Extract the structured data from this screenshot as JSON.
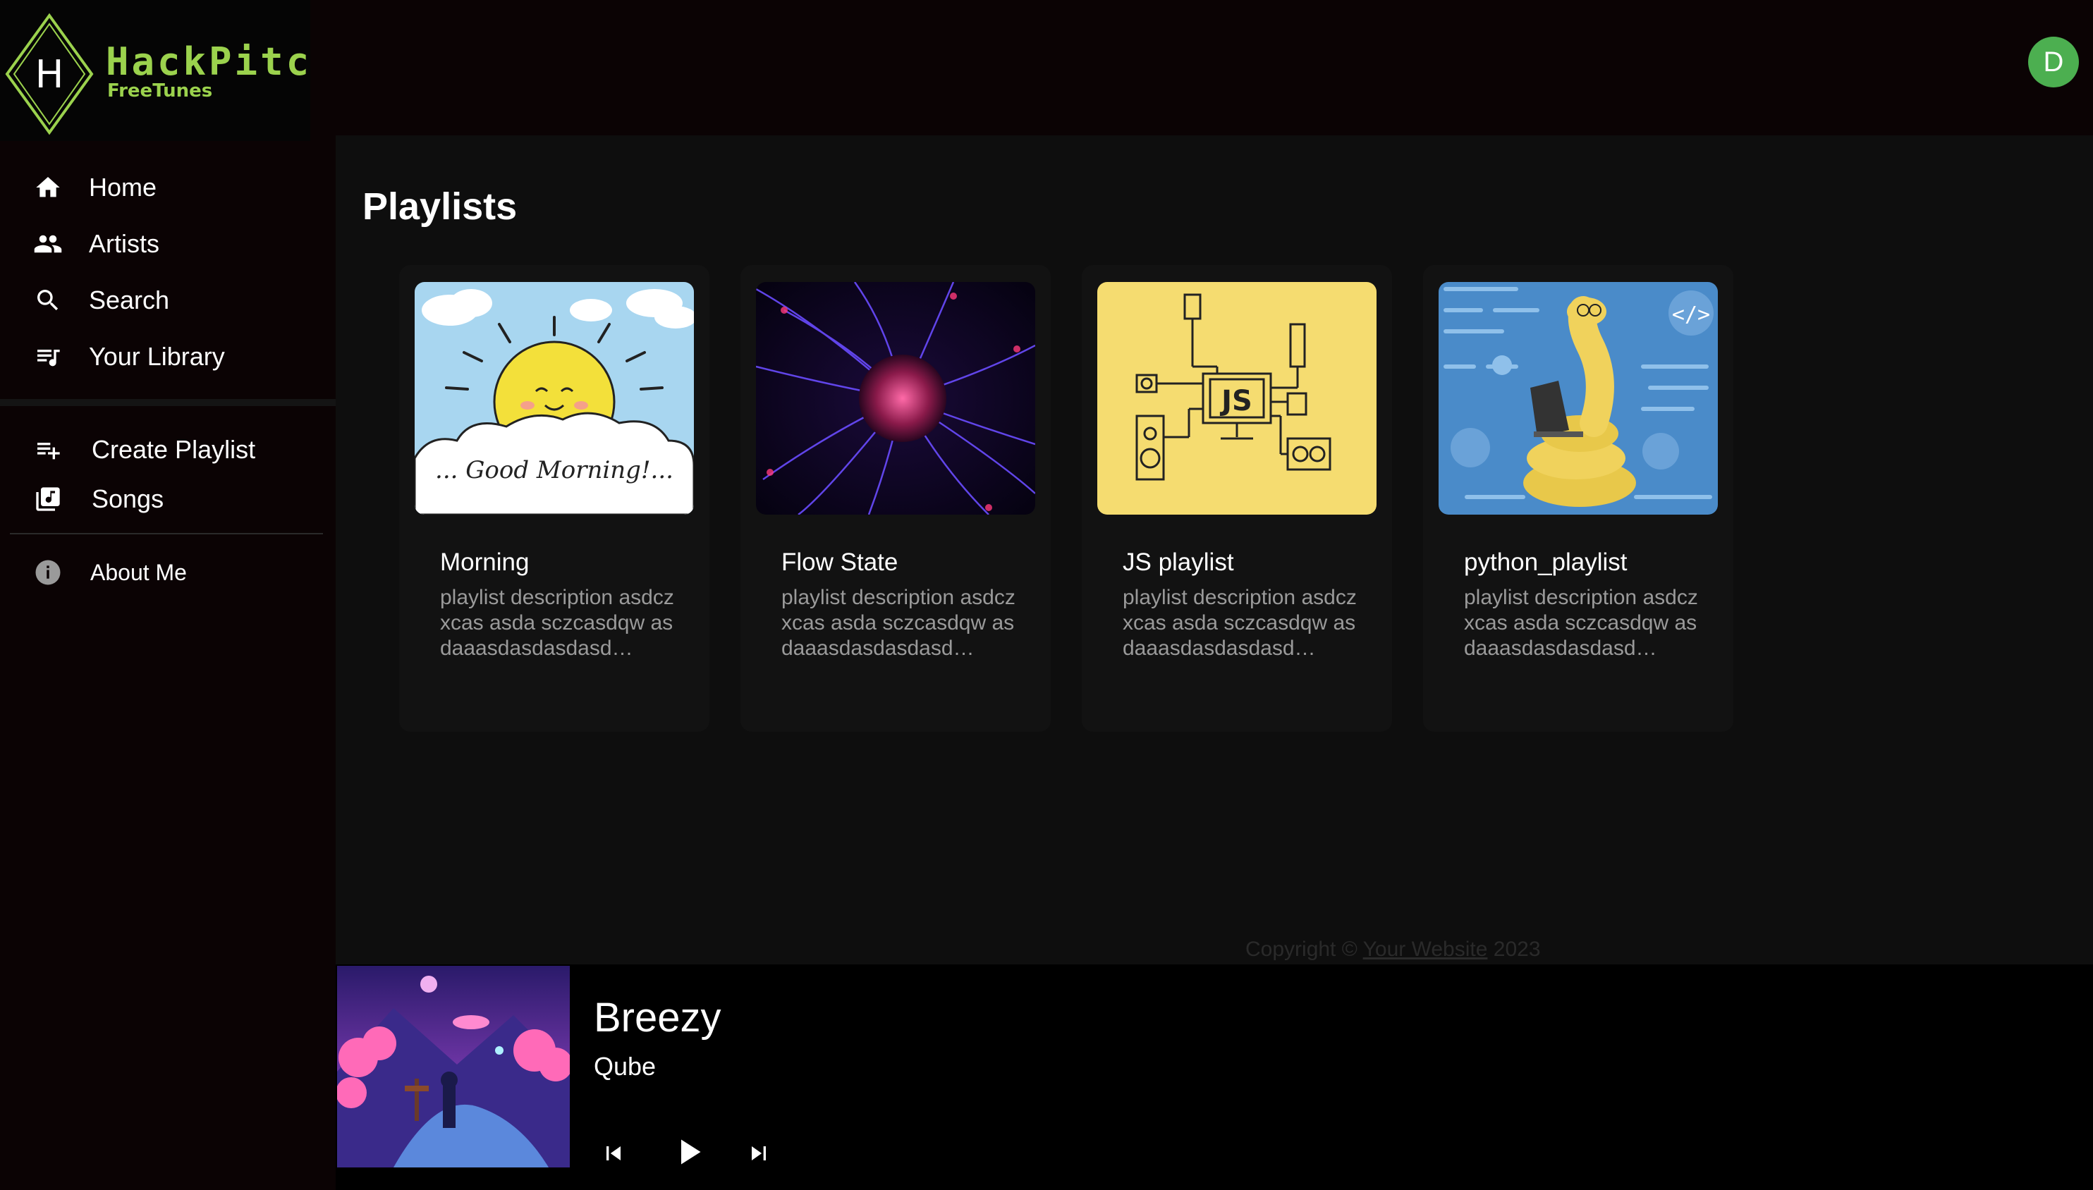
{
  "app": {
    "logo_title": "HackPitch",
    "logo_subtitle": "FreeTunes",
    "logo_letter": "H",
    "user_initial": "D"
  },
  "sidebar": {
    "items": [
      {
        "label": "Home",
        "icon": "home-icon"
      },
      {
        "label": "Artists",
        "icon": "people-icon"
      },
      {
        "label": "Search",
        "icon": "search-icon"
      },
      {
        "label": "Your Library",
        "icon": "library-music-icon"
      }
    ],
    "secondary": [
      {
        "label": "Create Playlist",
        "icon": "playlist-add-icon"
      },
      {
        "label": "Songs",
        "icon": "library-music-square-icon"
      }
    ],
    "about": {
      "label": "About Me",
      "icon": "info-icon"
    }
  },
  "main": {
    "title": "Playlists",
    "playlists": [
      {
        "name": "Morning",
        "description": "playlist description asdczxcas asda sczcasdqw asdaaasdasdasdasd…",
        "cover_text": "... Good Morning!..."
      },
      {
        "name": "Flow State",
        "description": "playlist description asdczxcas asda sczcasdqw asdaaasdasdasdasd…"
      },
      {
        "name": "JS playlist",
        "description": "playlist description asdczxcas asda sczcasdqw asdaaasdasdasdasd…",
        "cover_text": "JS"
      },
      {
        "name": "python_playlist",
        "description": "playlist description asdczxcas asda sczcasdqw asdaaasdasdasdasd…"
      }
    ]
  },
  "footer": {
    "prefix": "Copyright ©",
    "link": "Your Website",
    "year": "2023"
  },
  "player": {
    "title": "Breezy",
    "artist": "Qube"
  },
  "colors": {
    "accent_green": "#9bd24d",
    "avatar": "#4caf50",
    "sidebar_bg": "#0b0304",
    "main_bg": "#0e0e0e",
    "card_bg": "#121212"
  }
}
